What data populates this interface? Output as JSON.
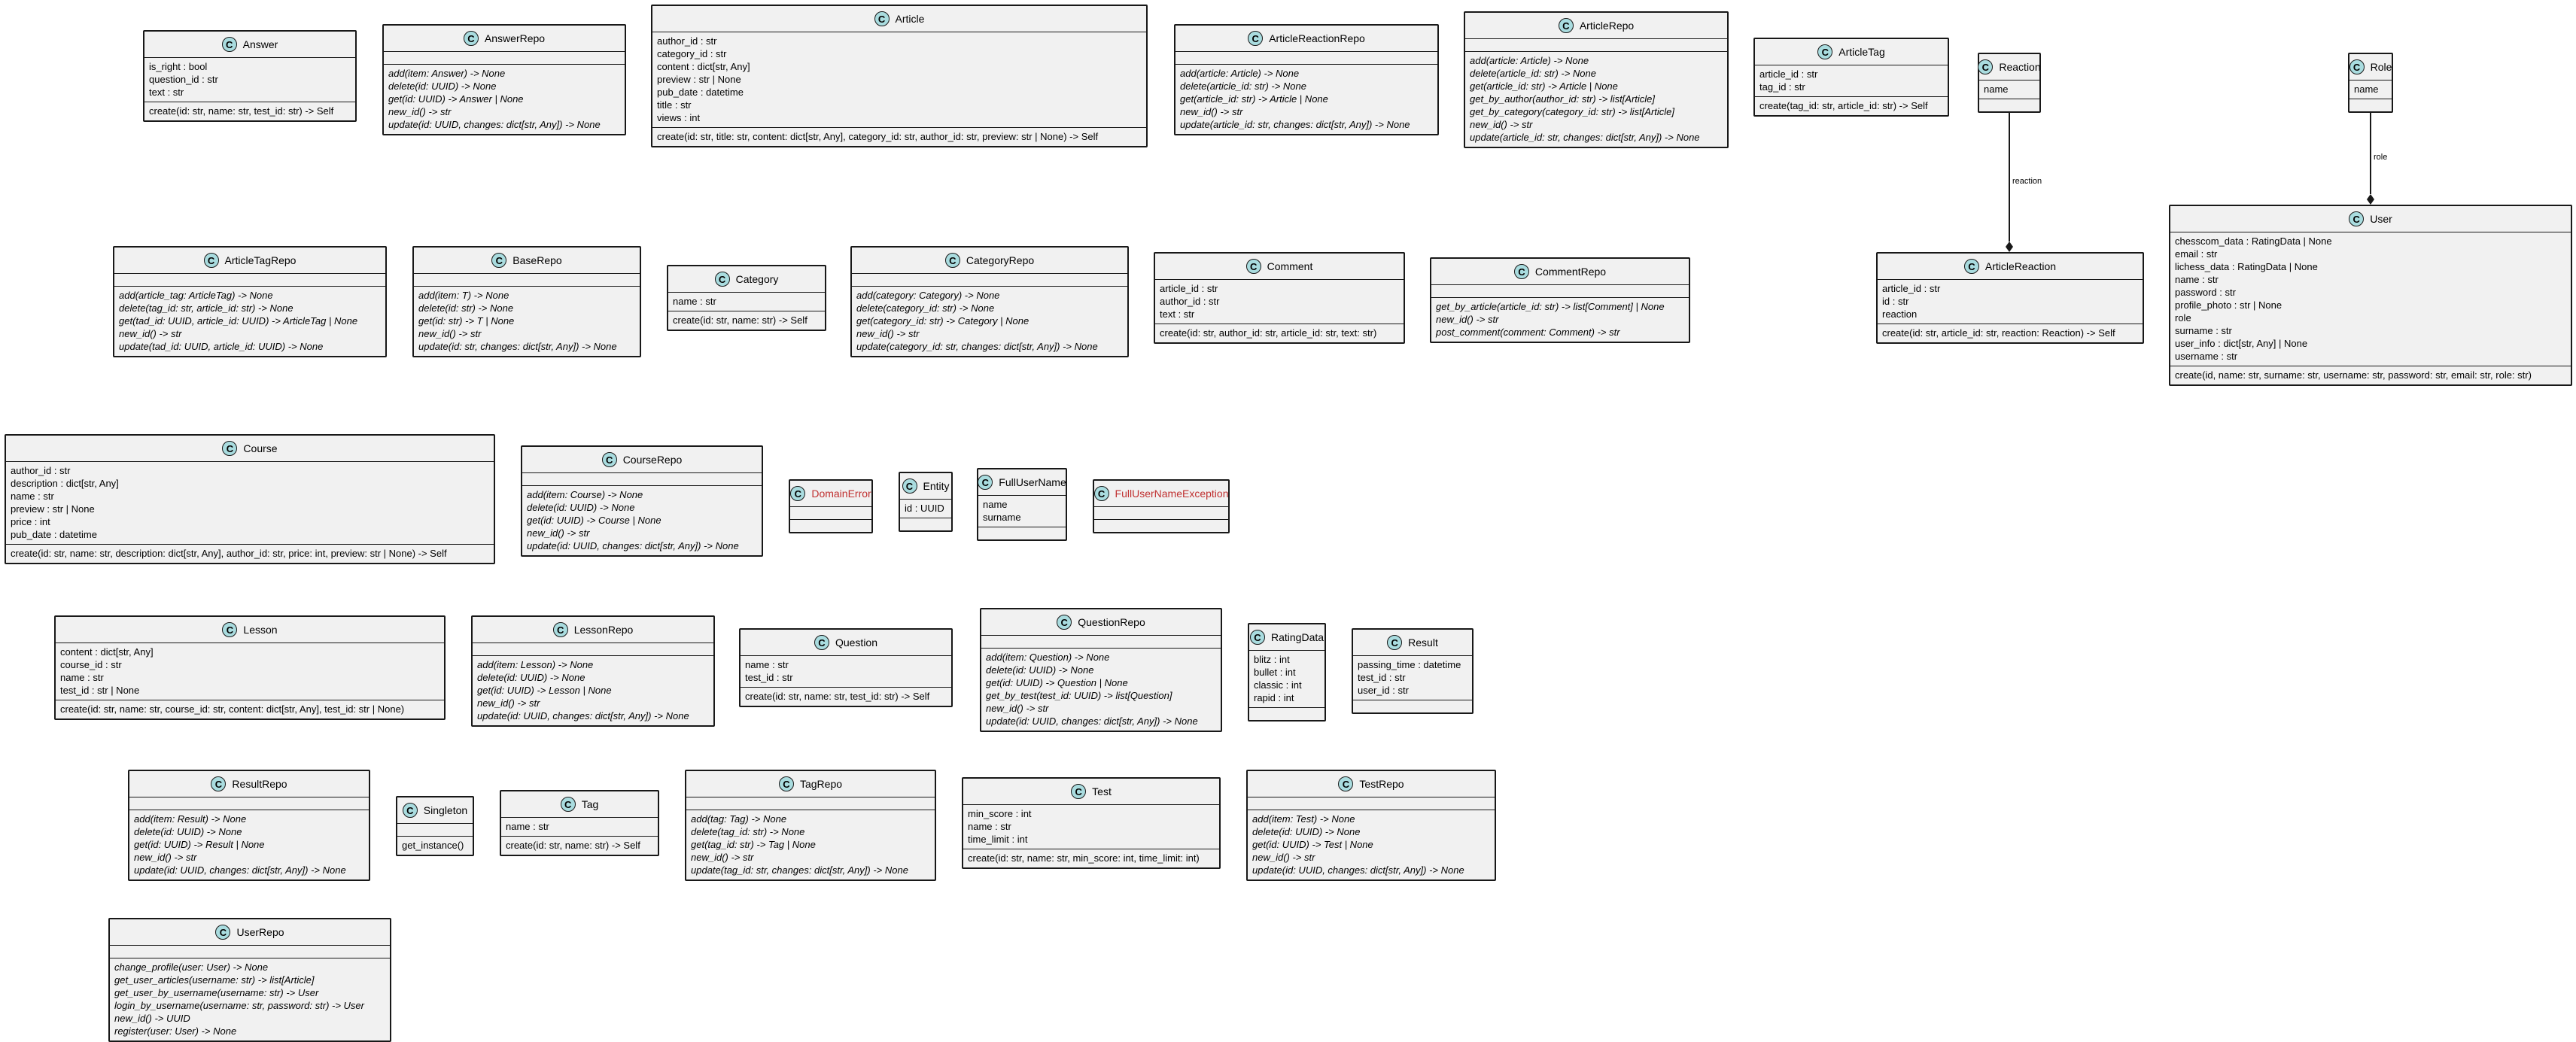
{
  "relations": [
    {
      "from": "Reaction",
      "to": "ArticleReaction",
      "label": "reaction"
    },
    {
      "from": "Role",
      "to": "User",
      "label": "role"
    }
  ],
  "classes": [
    {
      "name": "Answer",
      "fields": [
        "is_right : bool",
        "question_id : str",
        "text : str"
      ],
      "methods": [
        "create(id: str, name: str, test_id: str) -> Self"
      ]
    },
    {
      "name": "AnswerRepo",
      "fields": [],
      "methods": [
        "add(item: Answer) -> None",
        "delete(id: UUID) -> None",
        "get(id: UUID) -> Answer | None",
        "new_id() -> str",
        "update(id: UUID, changes: dict[str, Any]) -> None"
      ],
      "abstract": true
    },
    {
      "name": "Article",
      "fields": [
        "author_id : str",
        "category_id : str",
        "content : dict[str, Any]",
        "preview : str | None",
        "pub_date : datetime",
        "title : str",
        "views : int"
      ],
      "methods": [
        "create(id: str, title: str, content: dict[str, Any], category_id: str, author_id: str, preview: str | None) -> Self"
      ]
    },
    {
      "name": "ArticleReactionRepo",
      "fields": [],
      "methods": [
        "add(article: Article) -> None",
        "delete(article_id: str) -> None",
        "get(article_id: str) -> Article | None",
        "new_id() -> str",
        "update(article_id: str, changes: dict[str, Any]) -> None"
      ],
      "abstract": true
    },
    {
      "name": "ArticleRepo",
      "fields": [],
      "methods": [
        "add(article: Article) -> None",
        "delete(article_id: str) -> None",
        "get(article_id: str) -> Article | None",
        "get_by_author(author_id: str) -> list[Article]",
        "get_by_category(category_id: str) -> list[Article]",
        "new_id() -> str",
        "update(article_id: str, changes: dict[str, Any]) -> None"
      ],
      "abstract": true
    },
    {
      "name": "ArticleTag",
      "fields": [
        "article_id : str",
        "tag_id : str"
      ],
      "methods": [
        "create(tag_id: str, article_id: str) -> Self"
      ]
    },
    {
      "name": "Reaction",
      "fields": [
        "name"
      ],
      "methods": []
    },
    {
      "name": "Role",
      "fields": [
        "name"
      ],
      "methods": []
    },
    {
      "name": "ArticleTagRepo",
      "fields": [],
      "methods": [
        "add(article_tag: ArticleTag) -> None",
        "delete(tag_id: str, article_id: str) -> None",
        "get(tad_id: UUID, article_id: UUID) -> ArticleTag | None",
        "new_id() -> str",
        "update(tad_id: UUID, article_id: UUID) -> None"
      ],
      "abstract": true
    },
    {
      "name": "BaseRepo",
      "fields": [],
      "methods": [
        "add(item: T) -> None",
        "delete(id: str) -> None",
        "get(id: str) -> T | None",
        "new_id() -> str",
        "update(id: str, changes: dict[str, Any]) -> None"
      ],
      "abstract": true
    },
    {
      "name": "Category",
      "fields": [
        "name : str"
      ],
      "methods": [
        "create(id: str, name: str) -> Self"
      ]
    },
    {
      "name": "CategoryRepo",
      "fields": [],
      "methods": [
        "add(category: Category) -> None",
        "delete(category_id: str) -> None",
        "get(category_id: str) -> Category | None",
        "new_id() -> str",
        "update(category_id: str, changes: dict[str, Any]) -> None"
      ],
      "abstract": true
    },
    {
      "name": "Comment",
      "fields": [
        "article_id : str",
        "author_id : str",
        "text : str"
      ],
      "methods": [
        "create(id: str, author_id: str, article_id: str, text: str)"
      ]
    },
    {
      "name": "CommentRepo",
      "fields": [],
      "methods": [
        "get_by_article(article_id: str) -> list[Comment] | None",
        "new_id() -> str",
        "post_comment(comment: Comment) -> str"
      ],
      "abstract": true
    },
    {
      "name": "ArticleReaction",
      "fields": [
        "article_id : str",
        "id : str",
        "reaction"
      ],
      "methods": [
        "create(id: str, article_id: str, reaction: Reaction) -> Self"
      ]
    },
    {
      "name": "User",
      "fields": [
        "chesscom_data : RatingData | None",
        "email : str",
        "lichess_data : RatingData | None",
        "name : str",
        "password : str",
        "profile_photo : str | None",
        "role",
        "surname : str",
        "user_info : dict[str, Any] | None",
        "username : str"
      ],
      "methods": [
        "create(id, name: str, surname: str, username: str, password: str, email: str, role: str)"
      ]
    },
    {
      "name": "Course",
      "fields": [
        "author_id : str",
        "description : dict[str, Any]",
        "name : str",
        "preview : str | None",
        "price : int",
        "pub_date : datetime"
      ],
      "methods": [
        "create(id: str, name: str, description: dict[str, Any], author_id: str, price: int, preview: str | None) -> Self"
      ]
    },
    {
      "name": "CourseRepo",
      "fields": [],
      "methods": [
        "add(item: Course) -> None",
        "delete(id: UUID) -> None",
        "get(id: UUID) -> Course | None",
        "new_id() -> str",
        "update(id: UUID, changes: dict[str, Any]) -> None"
      ],
      "abstract": true
    },
    {
      "name": "DomainError",
      "fields": [],
      "methods": [],
      "exception": true
    },
    {
      "name": "Entity",
      "fields": [
        "id : UUID"
      ],
      "methods": []
    },
    {
      "name": "FullUserName",
      "fields": [
        "name",
        "surname"
      ],
      "methods": []
    },
    {
      "name": "FullUserNameException",
      "fields": [],
      "methods": [],
      "exception": true
    },
    {
      "name": "Lesson",
      "fields": [
        "content : dict[str, Any]",
        "course_id : str",
        "name : str",
        "test_id : str | None"
      ],
      "methods": [
        "create(id: str, name: str, course_id: str, content: dict[str, Any], test_id: str | None)"
      ]
    },
    {
      "name": "LessonRepo",
      "fields": [],
      "methods": [
        "add(item: Lesson) -> None",
        "delete(id: UUID) -> None",
        "get(id: UUID) -> Lesson | None",
        "new_id() -> str",
        "update(id: UUID, changes: dict[str, Any]) -> None"
      ],
      "abstract": true
    },
    {
      "name": "Question",
      "fields": [
        "name : str",
        "test_id : str"
      ],
      "methods": [
        "create(id: str, name: str, test_id: str) -> Self"
      ]
    },
    {
      "name": "QuestionRepo",
      "fields": [],
      "methods": [
        "add(item: Question) -> None",
        "delete(id: UUID) -> None",
        "get(id: UUID) -> Question | None",
        "get_by_test(test_id: UUID) -> list[Question]",
        "new_id() -> str",
        "update(id: UUID, changes: dict[str, Any]) -> None"
      ],
      "abstract": true
    },
    {
      "name": "RatingData",
      "fields": [
        "blitz : int",
        "bullet : int",
        "classic : int",
        "rapid : int"
      ],
      "methods": []
    },
    {
      "name": "Result",
      "fields": [
        "passing_time : datetime",
        "test_id : str",
        "user_id : str"
      ],
      "methods": []
    },
    {
      "name": "ResultRepo",
      "fields": [],
      "methods": [
        "add(item: Result) -> None",
        "delete(id: UUID) -> None",
        "get(id: UUID) -> Result | None",
        "new_id() -> str",
        "update(id: UUID, changes: dict[str, Any]) -> None"
      ],
      "abstract": true
    },
    {
      "name": "Singleton",
      "fields": [],
      "methods": [
        "get_instance()"
      ]
    },
    {
      "name": "Tag",
      "fields": [
        "name : str"
      ],
      "methods": [
        "create(id: str, name: str) -> Self"
      ]
    },
    {
      "name": "TagRepo",
      "fields": [],
      "methods": [
        "add(tag: Tag) -> None",
        "delete(tag_id: str) -> None",
        "get(tag_id: str) -> Tag | None",
        "new_id() -> str",
        "update(tag_id: str, changes: dict[str, Any]) -> None"
      ],
      "abstract": true
    },
    {
      "name": "Test",
      "fields": [
        "min_score : int",
        "name : str",
        "time_limit : int"
      ],
      "methods": [
        "create(id: str, name: str, min_score: int, time_limit: int)"
      ]
    },
    {
      "name": "TestRepo",
      "fields": [],
      "methods": [
        "add(item: Test) -> None",
        "delete(id: UUID) -> None",
        "get(id: UUID) -> Test | None",
        "new_id() -> str",
        "update(id: UUID, changes: dict[str, Any]) -> None"
      ],
      "abstract": true
    },
    {
      "name": "UserRepo",
      "fields": [],
      "methods": [
        "change_profile(user: User) -> None",
        "get_user_articles(username: str) -> list[Article]",
        "get_user_by_username(username: str) -> User",
        "login_by_username(username: str, password: str) -> User",
        "new_id() -> UUID",
        "register(user: User) -> None"
      ],
      "abstract": true
    }
  ]
}
